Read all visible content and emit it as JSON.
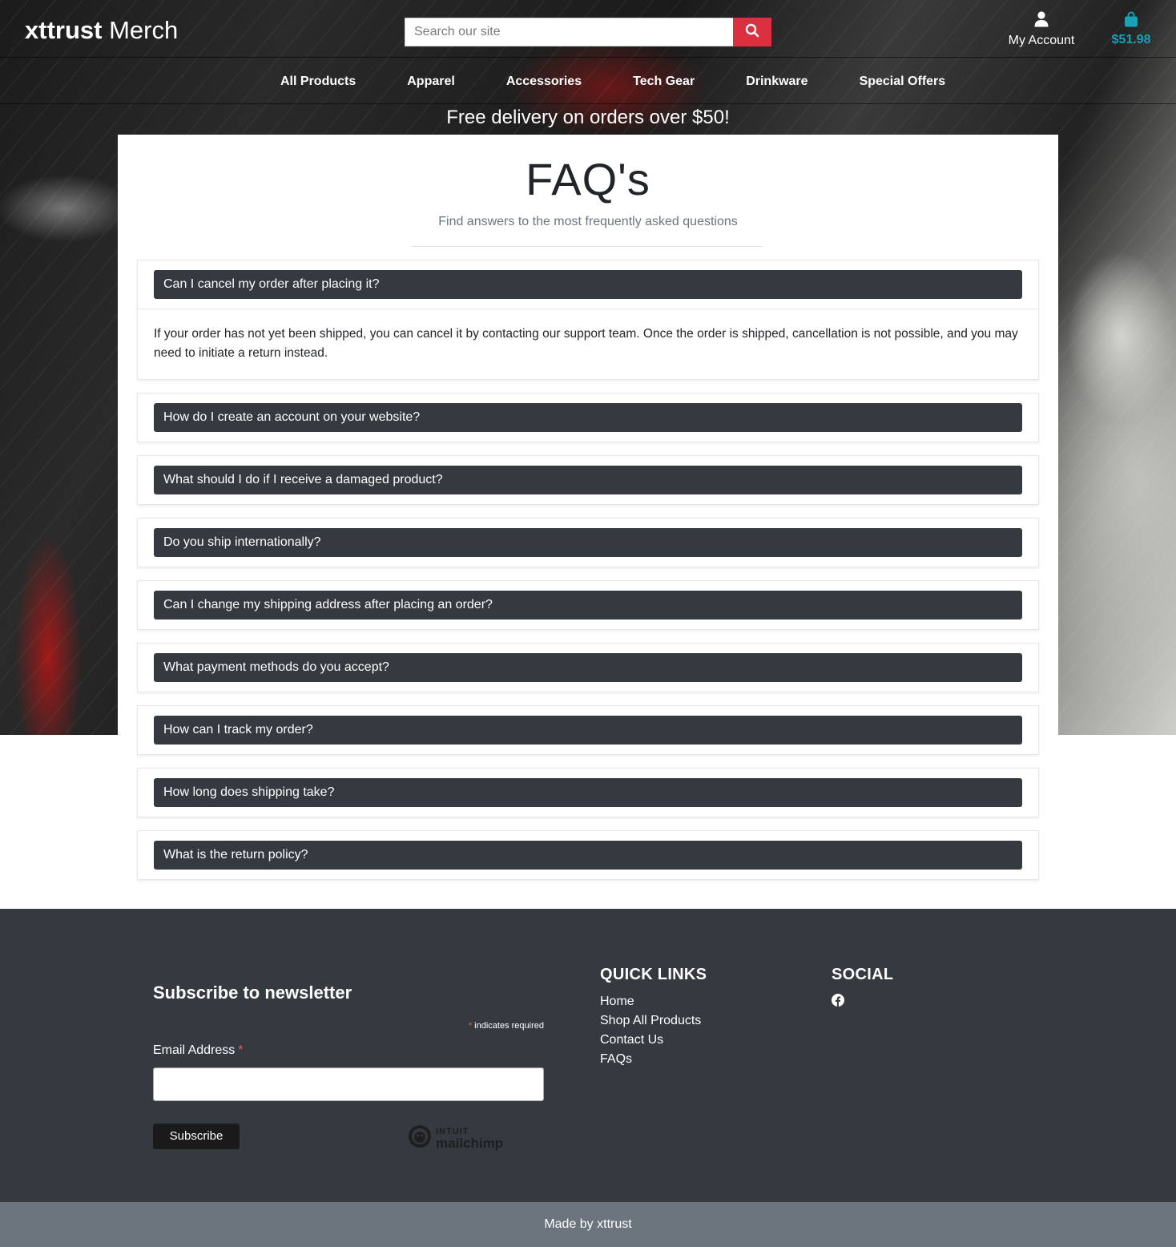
{
  "header": {
    "brand_bold": "xttrust",
    "brand_rest": " Merch",
    "search_placeholder": "Search our site",
    "account_label": "My Account",
    "cart_total": "$51.98"
  },
  "nav": {
    "items": [
      "All Products",
      "Apparel",
      "Accessories",
      "Tech Gear",
      "Drinkware",
      "Special Offers"
    ]
  },
  "banner": {
    "text": "Free delivery on orders over $50!"
  },
  "faq": {
    "title": "FAQ's",
    "subtitle": "Find answers to the most frequently asked questions",
    "items": [
      {
        "question": "Can I cancel my order after placing it?",
        "answer": "If your order has not yet been shipped, you can cancel it by contacting our support team. Once the order is shipped, cancellation is not possible, and you may need to initiate a return instead."
      },
      {
        "question": "How do I create an account on your website?"
      },
      {
        "question": "What should I do if I receive a damaged product?"
      },
      {
        "question": "Do you ship internationally?"
      },
      {
        "question": "Can I change my shipping address after placing an order?"
      },
      {
        "question": "What payment methods do you accept?"
      },
      {
        "question": "How can I track my order?"
      },
      {
        "question": "How long does shipping take?"
      },
      {
        "question": "What is the return policy?"
      }
    ]
  },
  "footer": {
    "newsletter_title": "Subscribe to newsletter",
    "required_star": "*",
    "required_note": " indicates required",
    "email_label": "Email Address",
    "subscribe_label": "Subscribe",
    "mailchimp_top": "INTUIT",
    "mailchimp_bottom": "mailchimp",
    "quick_links_title": "QUICK LINKS",
    "quick_links": [
      "Home",
      "Shop All Products",
      "Contact Us",
      "FAQs"
    ],
    "social_title": "SOCIAL",
    "copyright": "Made by xttrust"
  },
  "colors": {
    "accent_red": "#dc3040",
    "cart_teal": "#17a2b8",
    "faq_header_bg": "#343a40",
    "footer_bg": "#343a40",
    "bottom_bar_bg": "#6c757d"
  },
  "icons": {
    "search_button": "search-icon",
    "account": "user-icon",
    "cart": "shopping-bag-icon",
    "social": "facebook-icon",
    "newsletter_logo": "mailchimp-logo"
  }
}
